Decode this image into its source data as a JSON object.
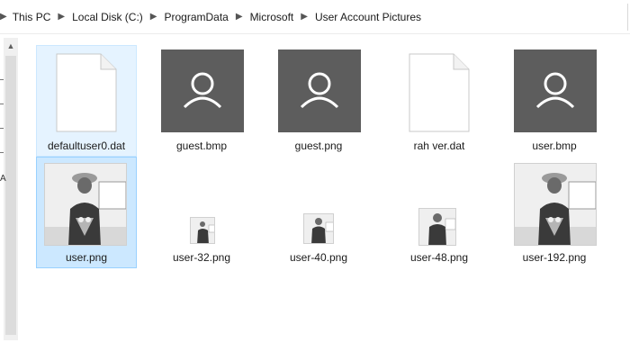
{
  "breadcrumb": [
    "This PC",
    "Local Disk (C:)",
    "ProgramData",
    "Microsoft",
    "User Account Pictures"
  ],
  "nav": {
    "collapsed_letter": "A"
  },
  "files": [
    {
      "name": "defaultuser0.dat",
      "kind": "document",
      "state": "selected"
    },
    {
      "name": "guest.bmp",
      "kind": "user-tile",
      "state": "normal"
    },
    {
      "name": "guest.png",
      "kind": "user-tile",
      "state": "normal"
    },
    {
      "name": "rah ver.dat",
      "kind": "document",
      "state": "normal"
    },
    {
      "name": "user.bmp",
      "kind": "user-tile",
      "state": "normal"
    },
    {
      "name": "user.png",
      "kind": "photo",
      "state": "focused"
    },
    {
      "name": "user-32.png",
      "kind": "photo",
      "state": "normal"
    },
    {
      "name": "user-40.png",
      "kind": "photo",
      "state": "normal"
    },
    {
      "name": "user-48.png",
      "kind": "photo",
      "state": "normal"
    },
    {
      "name": "user-192.png",
      "kind": "photo",
      "state": "normal"
    }
  ],
  "colors": {
    "selection": "#e5f3ff",
    "focus": "#cce8ff",
    "tile": "#5d5d5d"
  }
}
